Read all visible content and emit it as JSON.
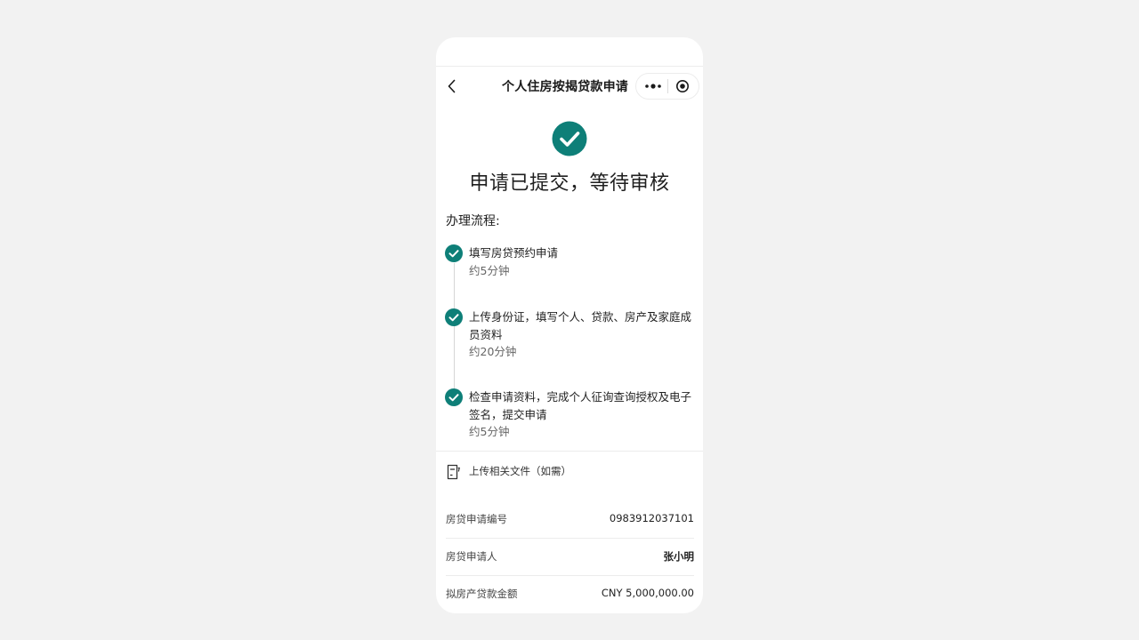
{
  "nav": {
    "title": "个人住房按揭贷款申请",
    "back_icon": "chevron-left-icon",
    "more_icon": "more-dots-icon",
    "close_icon": "target-circle-icon"
  },
  "result": {
    "icon": "check-circle-icon",
    "title": "申请已提交，等待审核",
    "accent_color": "#0e7f78"
  },
  "process": {
    "label": "办理流程:",
    "steps": [
      {
        "text": "填写房贷预约申请",
        "time": "约5分钟",
        "status": "done"
      },
      {
        "text": "上传身份证，填写个人、贷款、房产及家庭成员资料",
        "time": "约20分钟",
        "status": "done"
      },
      {
        "text": "检查申请资料，完成个人征询查询授权及电子签名，提交申请",
        "time": "约5分钟",
        "status": "done"
      }
    ]
  },
  "upload": {
    "icon": "document-upload-icon",
    "label": "上传相关文件（如需）"
  },
  "info": [
    {
      "label": "房贷申请编号",
      "value": "0983912037101"
    },
    {
      "label": "房贷申请人",
      "value": "张小明"
    },
    {
      "label": "拟房产贷款金额",
      "value": "CNY 5,000,000.00"
    }
  ]
}
